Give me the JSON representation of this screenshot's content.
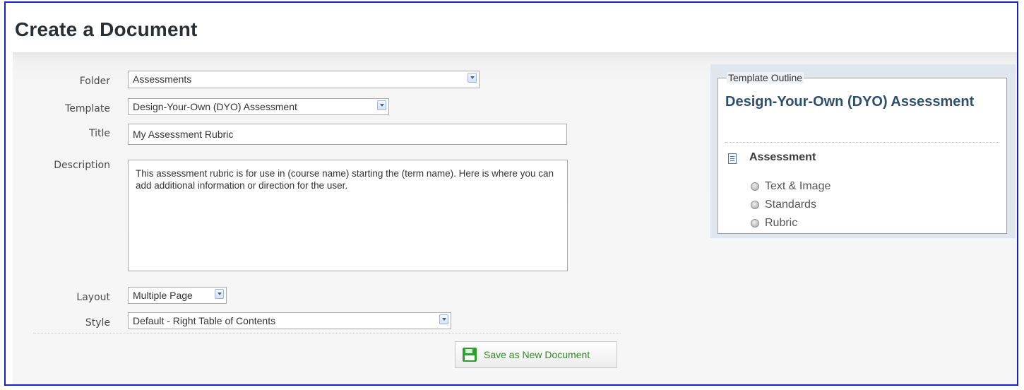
{
  "page": {
    "title": "Create a Document"
  },
  "form": {
    "folder": {
      "label": "Folder",
      "value": "Assessments"
    },
    "template": {
      "label": "Template",
      "value": "Design-Your-Own (DYO) Assessment"
    },
    "title": {
      "label": "Title",
      "value": "My Assessment Rubric"
    },
    "description": {
      "label": "Description",
      "value": "This assessment rubric is for use in (course name) starting the (term name). Here is where you can add additional information or direction for the user."
    },
    "layout": {
      "label": "Layout",
      "value": "Multiple Page"
    },
    "style": {
      "label": "Style",
      "value": "Default - Right Table of Contents"
    },
    "save_label": "Save as New Document"
  },
  "outline": {
    "legend": "Template Outline",
    "title": "Design-Your-Own (DYO) Assessment",
    "section": {
      "label": "Assessment",
      "icon": "document-icon",
      "items": [
        {
          "label": "Text & Image"
        },
        {
          "label": "Standards"
        },
        {
          "label": "Rubric"
        }
      ]
    }
  },
  "colors": {
    "frame_border": "#1b20c4",
    "outline_title": "#2e4e6e",
    "save_text": "#2e8a28"
  }
}
